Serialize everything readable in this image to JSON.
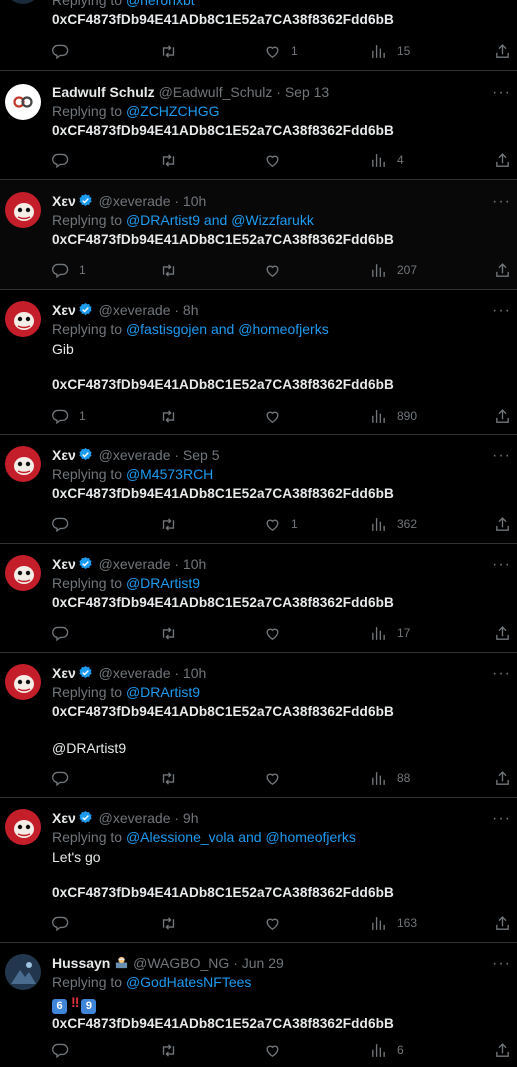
{
  "tweets": [
    {
      "id": "t0",
      "reply_prefix": "Replying to ",
      "reply_mentions": [
        "@heronxbt"
      ],
      "lines": [
        "0xCF4873fDb94E41ADb8C1E52a7CA38f8362Fdd6bB"
      ],
      "counts": {
        "replies": "",
        "retweets": "",
        "likes": "1",
        "views": "15"
      }
    },
    {
      "id": "t1",
      "name": "Eadwulf Schulz",
      "handle": "@Eadwulf_Schulz",
      "time": "· Sep 13",
      "avatar_color": "#ffffff",
      "reply_prefix": "Replying to ",
      "reply_mentions": [
        "@ZCHZCHGG"
      ],
      "lines": [
        "0xCF4873fDb94E41ADb8C1E52a7CA38f8362Fdd6bB"
      ],
      "counts": {
        "replies": "",
        "retweets": "",
        "likes": "",
        "views": "4"
      }
    },
    {
      "id": "t2",
      "name": "Χεν",
      "handle": "@xeverade",
      "time": "· 10h",
      "reply_prefix": "Replying to ",
      "reply_mentions": [
        "@DRArtist9",
        "@Wizzfarukk"
      ],
      "lines": [
        "0xCF4873fDb94E41ADb8C1E52a7CA38f8362Fdd6bB"
      ],
      "counts": {
        "replies": "1",
        "retweets": "",
        "likes": "",
        "views": "207"
      }
    },
    {
      "id": "t3",
      "name": "Χεν",
      "handle": "@xeverade",
      "time": "· 8h",
      "reply_prefix": "Replying to ",
      "reply_mentions": [
        "@fastisgojen",
        "@homeofjerks"
      ],
      "text_top": "Gib",
      "lines": [
        "0xCF4873fDb94E41ADb8C1E52a7CA38f8362Fdd6bB"
      ],
      "counts": {
        "replies": "1",
        "retweets": "",
        "likes": "",
        "views": "890"
      }
    },
    {
      "id": "t4",
      "name": "Χεν",
      "handle": "@xeverade",
      "time": "· Sep 5",
      "reply_prefix": "Replying to ",
      "reply_mentions": [
        "@M4573RCH"
      ],
      "lines": [
        "0xCF4873fDb94E41ADb8C1E52a7CA38f8362Fdd6bB"
      ],
      "counts": {
        "replies": "",
        "retweets": "",
        "likes": "1",
        "views": "362"
      }
    },
    {
      "id": "t5",
      "name": "Χεν",
      "handle": "@xeverade",
      "time": "· 10h",
      "reply_prefix": "Replying to ",
      "reply_mentions": [
        "@DRArtist9"
      ],
      "lines": [
        "0xCF4873fDb94E41ADb8C1E52a7CA38f8362Fdd6bB"
      ],
      "counts": {
        "replies": "",
        "retweets": "",
        "likes": "",
        "views": "17"
      }
    },
    {
      "id": "t6",
      "name": "Χεν",
      "handle": "@xeverade",
      "time": "· 10h",
      "reply_prefix": "Replying to ",
      "reply_mentions": [
        "@DRArtist9"
      ],
      "lines": [
        "0xCF4873fDb94E41ADb8C1E52a7CA38f8362Fdd6bB"
      ],
      "text_bottom_link": "@DRArtist9",
      "counts": {
        "replies": "",
        "retweets": "",
        "likes": "",
        "views": "88"
      }
    },
    {
      "id": "t7",
      "name": "Χεν",
      "handle": "@xeverade",
      "time": "· 9h",
      "reply_prefix": "Replying to ",
      "reply_mentions": [
        "@Alessione_vola",
        "@homeofjerks"
      ],
      "text_top": "Let's go",
      "lines": [
        "0xCF4873fDb94E41ADb8C1E52a7CA38f8362Fdd6bB"
      ],
      "counts": {
        "replies": "",
        "retweets": "",
        "likes": "",
        "views": "163"
      }
    },
    {
      "id": "t8",
      "name": "Hussayn",
      "handle": "@WAGBO_NG",
      "time": "· Jun 29",
      "reply_prefix": "Replying to ",
      "reply_mentions": [
        "@GodHatesNFTees"
      ],
      "emoji_line": [
        "6",
        "‼",
        "9"
      ],
      "lines": [
        "0xCF4873fDb94E41ADb8C1E52a7CA38f8362Fdd6bB"
      ],
      "counts": {
        "replies": "",
        "retweets": "",
        "likes": "",
        "views": "6"
      }
    }
  ],
  "and_word": " and ",
  "more_glyph": "···",
  "colors": {
    "link": "#1d9bf0",
    "muted": "#71767b",
    "text": "#e7e9ea",
    "divider": "#2f3336",
    "verified": "#1d9bf0"
  }
}
